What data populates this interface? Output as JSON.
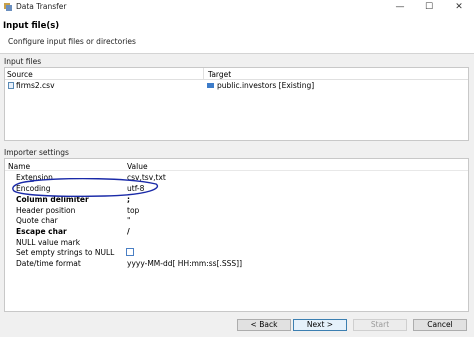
{
  "window": {
    "title": "Data Transfer",
    "minimize": "—",
    "maximize": "☐",
    "close": "✕"
  },
  "header": {
    "title": "Input file(s)",
    "subtitle": "Configure input files or directories"
  },
  "input_files": {
    "group_label": "Input files",
    "columns": [
      "Source",
      "Target"
    ],
    "rows": [
      {
        "source": "firms2.csv",
        "target": "public.investors [Existing]"
      }
    ]
  },
  "importer_settings": {
    "group_label": "Importer settings",
    "columns": [
      "Name",
      "Value"
    ],
    "rows": [
      {
        "name": "Extension",
        "value": "csv,tsv,txt"
      },
      {
        "name": "Encoding",
        "value": "utf-8"
      },
      {
        "name": "Column delimiter",
        "value": ";"
      },
      {
        "name": "Header position",
        "value": "top"
      },
      {
        "name": "Quote char",
        "value": "\""
      },
      {
        "name": "Escape char",
        "value": "/"
      },
      {
        "name": "NULL value mark",
        "value": ""
      },
      {
        "name": "Set empty strings to NULL",
        "value": ""
      },
      {
        "name": "Date/time format",
        "value": "yyyy-MM-dd[ HH:mm:ss[.SSS]]"
      }
    ]
  },
  "buttons": {
    "back": "< Back",
    "next": "Next >",
    "start": "Start",
    "cancel": "Cancel"
  },
  "colors": {
    "accent": "#3c7fb1",
    "annotation": "#1a2aa8"
  }
}
